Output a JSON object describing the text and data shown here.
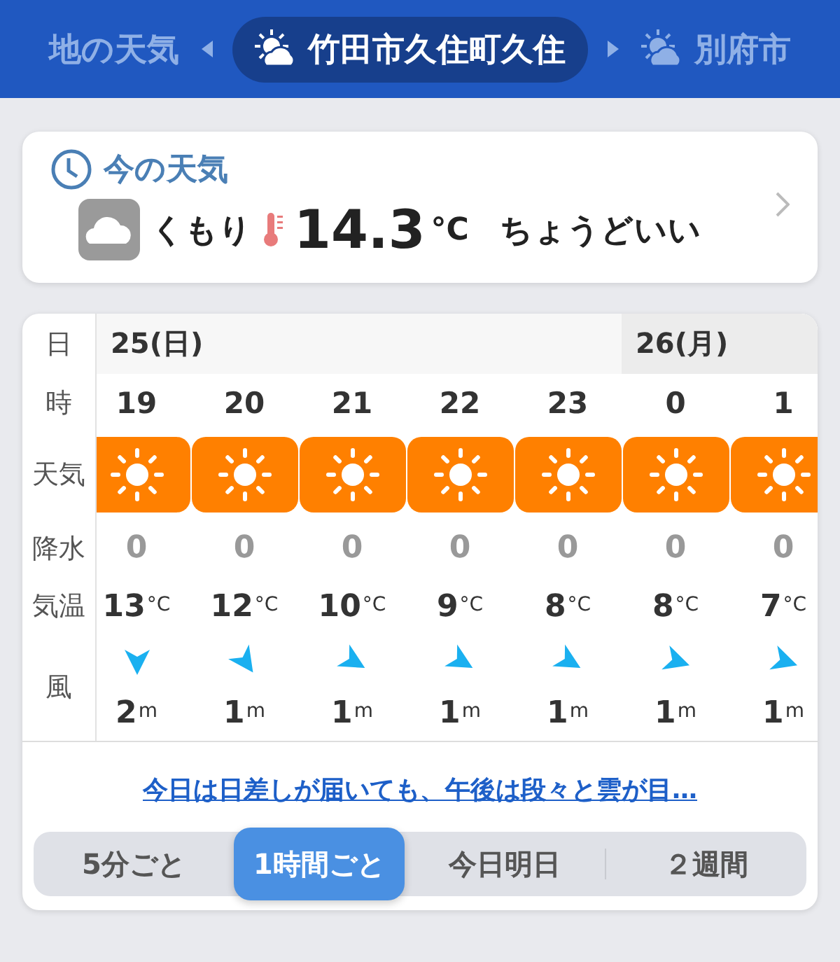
{
  "locations": [
    {
      "label": "地の天気",
      "selected": false
    },
    {
      "label": "竹田市久住町久住",
      "selected": true,
      "icon": {
        "kind": "sun-cloud"
      }
    },
    {
      "label": "別府市",
      "selected": false,
      "icon": {
        "kind": "sun-cloud"
      }
    }
  ],
  "current": {
    "title": "今の天気",
    "weather": {
      "kind": "cloudy"
    },
    "condition": "くもり",
    "temperature": "14.3",
    "unit": "°C",
    "feeling": "ちょうどいい"
  },
  "forecast": {
    "row_labels": [
      "日",
      "時",
      "天気",
      "降水",
      "気温",
      "風"
    ],
    "days": [
      {
        "date": "25(日)",
        "hours": [
          {
            "hour": "19",
            "weather": {
              "kind": "sunny"
            },
            "precip": "0",
            "temp": "13",
            "temp_unit": "°C",
            "wind_arrow": {
              "kind": "north"
            },
            "wind": "2",
            "wind_unit": "m"
          },
          {
            "hour": "20",
            "weather": {
              "kind": "sunny"
            },
            "precip": "0",
            "temp": "12",
            "temp_unit": "°C",
            "wind_arrow": {
              "kind": "northwest"
            },
            "wind": "1",
            "wind_unit": "m"
          },
          {
            "hour": "21",
            "weather": {
              "kind": "sunny"
            },
            "precip": "0",
            "temp": "10",
            "temp_unit": "°C",
            "wind_arrow": {
              "kind": "westnorthwest"
            },
            "wind": "1",
            "wind_unit": "m"
          },
          {
            "hour": "22",
            "weather": {
              "kind": "sunny"
            },
            "precip": "0",
            "temp": "9",
            "temp_unit": "°C",
            "wind_arrow": {
              "kind": "westnorthwest"
            },
            "wind": "1",
            "wind_unit": "m"
          },
          {
            "hour": "23",
            "weather": {
              "kind": "sunny"
            },
            "precip": "0",
            "temp": "8",
            "temp_unit": "°C",
            "wind_arrow": {
              "kind": "westnorthwest"
            },
            "wind": "1",
            "wind_unit": "m"
          }
        ]
      },
      {
        "date": "26(月)",
        "hours": [
          {
            "hour": "0",
            "weather": {
              "kind": "sunny"
            },
            "precip": "0",
            "temp": "8",
            "temp_unit": "°C",
            "wind_arrow": {
              "kind": "west"
            },
            "wind": "1",
            "wind_unit": "m"
          },
          {
            "hour": "1",
            "weather": {
              "kind": "sunny"
            },
            "precip": "0",
            "temp": "7",
            "temp_unit": "°C",
            "wind_arrow": {
              "kind": "west"
            },
            "wind": "1",
            "wind_unit": "m"
          }
        ]
      }
    ],
    "summary": "今日は日差しが届いても、午後は段々と雲が目…",
    "intervals": [
      {
        "label": "5分ごと",
        "selected": false
      },
      {
        "label": "1時間ごと",
        "selected": true
      },
      {
        "label": "今日明日",
        "selected": false
      },
      {
        "label": "２週間",
        "selected": false
      }
    ]
  }
}
